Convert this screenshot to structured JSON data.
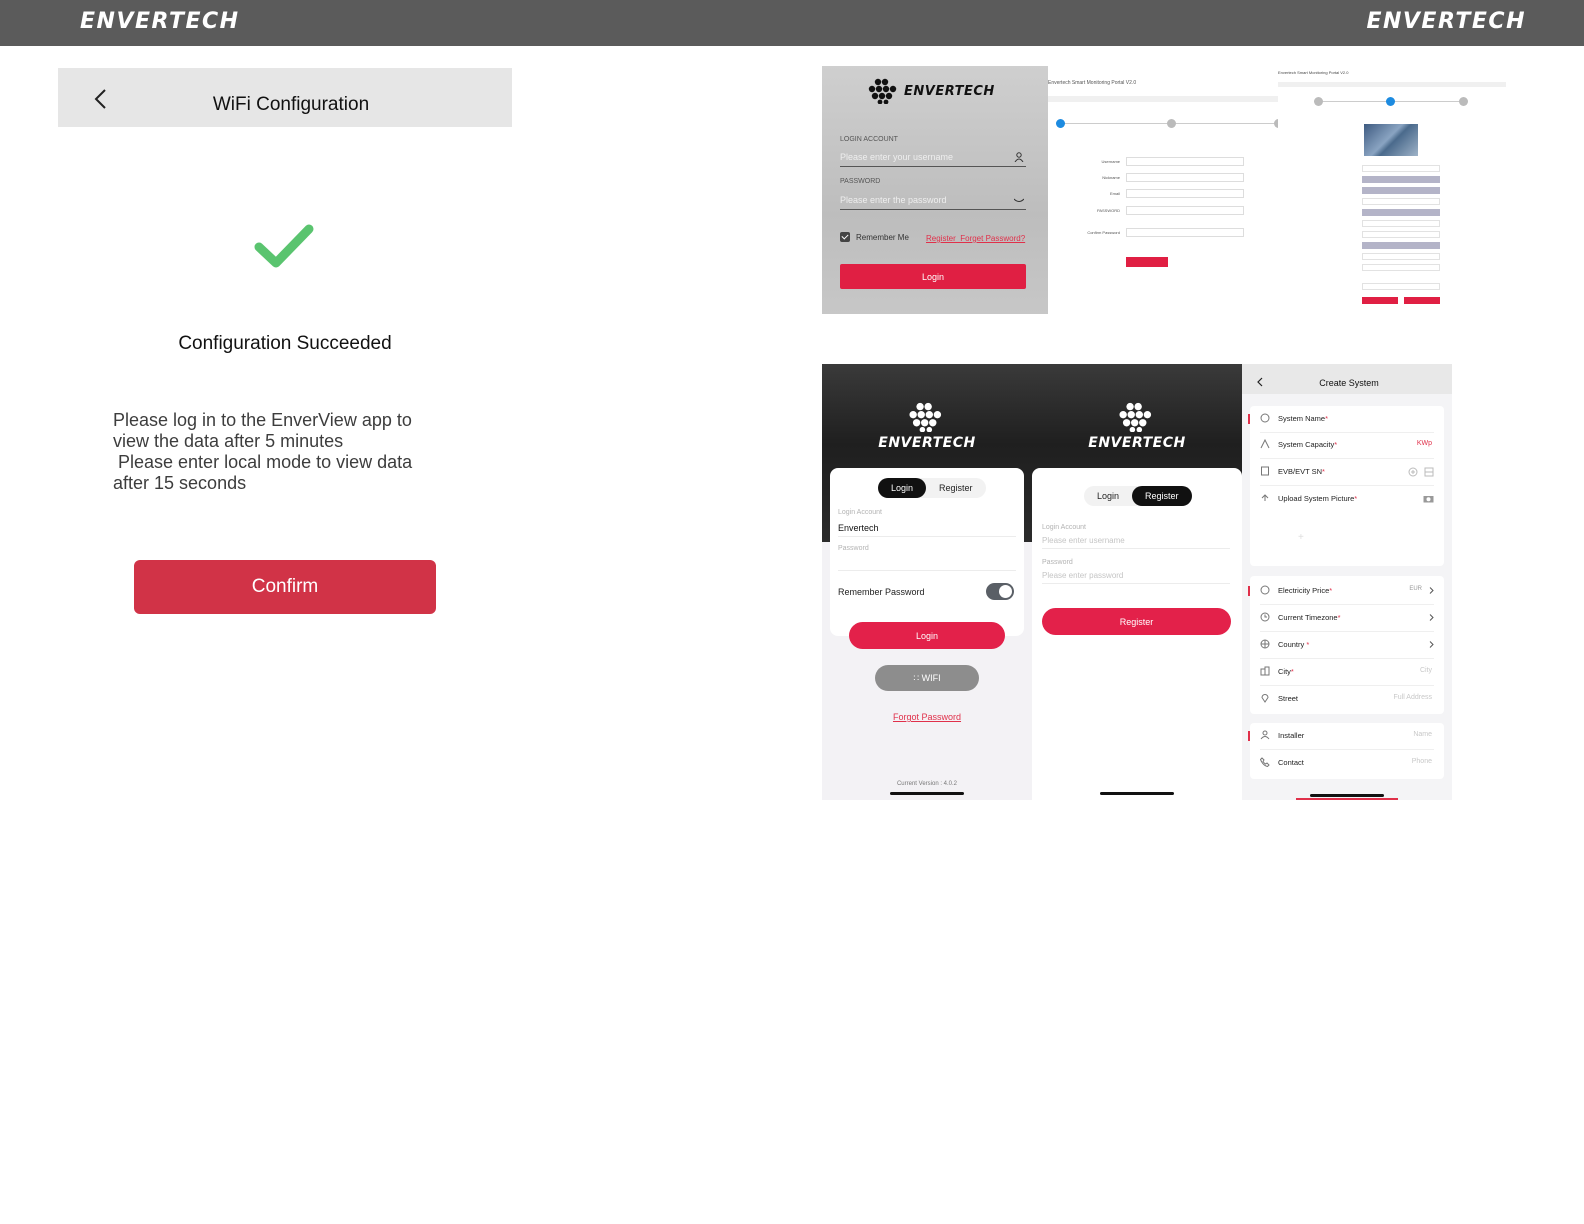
{
  "banner": {
    "left_logo": "ENVERTECH",
    "right_logo": "ENVERTECH"
  },
  "wifi_config": {
    "title": "WiFi Configuration",
    "status": "Configuration Succeeded",
    "message_line1": "Please log in to the EnverView app to",
    "message_line2": "view the data after 5 minutes",
    "message_line3": " Please enter local mode to view data",
    "message_line4": "after 15 seconds",
    "confirm_label": "Confirm",
    "check_color": "#5ac46f",
    "confirm_color": "#d13347"
  },
  "web_login": {
    "logo": "ENVERTECH",
    "account_label": "LOGIN ACCOUNT",
    "account_placeholder": "Please enter your username",
    "password_label": "PASSWORD",
    "password_placeholder": "Please enter the password",
    "remember": "Remember Me",
    "links": "Register  Forget Password?",
    "login_label": "Login"
  },
  "web_register": {
    "header": "Envertech Smart Monitoring Portal V2.0",
    "fields": [
      "Username",
      "Nickname",
      "Email",
      "PASSWORD",
      "Confirm Password"
    ]
  },
  "web_create": {
    "header": "Envertech Smart Monitoring Portal V2.0"
  },
  "mobile_login": {
    "logo": "ENVERTECH",
    "tab_login": "Login",
    "tab_register": "Register",
    "account_label": "Login Account",
    "account_value": "Envertech",
    "password_label": "Password",
    "remember": "Remember Password",
    "login_label": "Login",
    "wifi_label": "WIFI",
    "forgot": "Forgot Password",
    "version": "Current Version : 4.0.2"
  },
  "mobile_register": {
    "logo": "ENVERTECH",
    "tab_login": "Login",
    "tab_register": "Register",
    "account_label": "Login Account",
    "account_placeholder": "Please enter username",
    "password_label": "Password",
    "password_placeholder": "Please enter password",
    "register_label": "Register"
  },
  "mobile_create": {
    "title": "Create System",
    "rows_a": [
      {
        "label": "System Name",
        "req": "*",
        "right": ""
      },
      {
        "label": "System Capacity",
        "req": "*",
        "right": "KWp"
      },
      {
        "label": "EVB/EVT SN",
        "req": "*",
        "right": ""
      },
      {
        "label": "Upload System Picture",
        "req": "*",
        "right": ""
      }
    ],
    "rows_b": [
      {
        "label": "Electricity Price",
        "req": "*",
        "right": "EUR"
      },
      {
        "label": "Current Timezone",
        "req": "*",
        "right": ""
      },
      {
        "label": "Country ",
        "req": "*",
        "right": ""
      },
      {
        "label": "City",
        "req": "*",
        "right": "City"
      },
      {
        "label": "Street",
        "req": "",
        "right": "Full Address"
      }
    ],
    "rows_c": [
      {
        "label": "Installer",
        "req": "",
        "right": "Name"
      },
      {
        "label": "Contact",
        "req": "",
        "right": "Phone"
      }
    ]
  }
}
